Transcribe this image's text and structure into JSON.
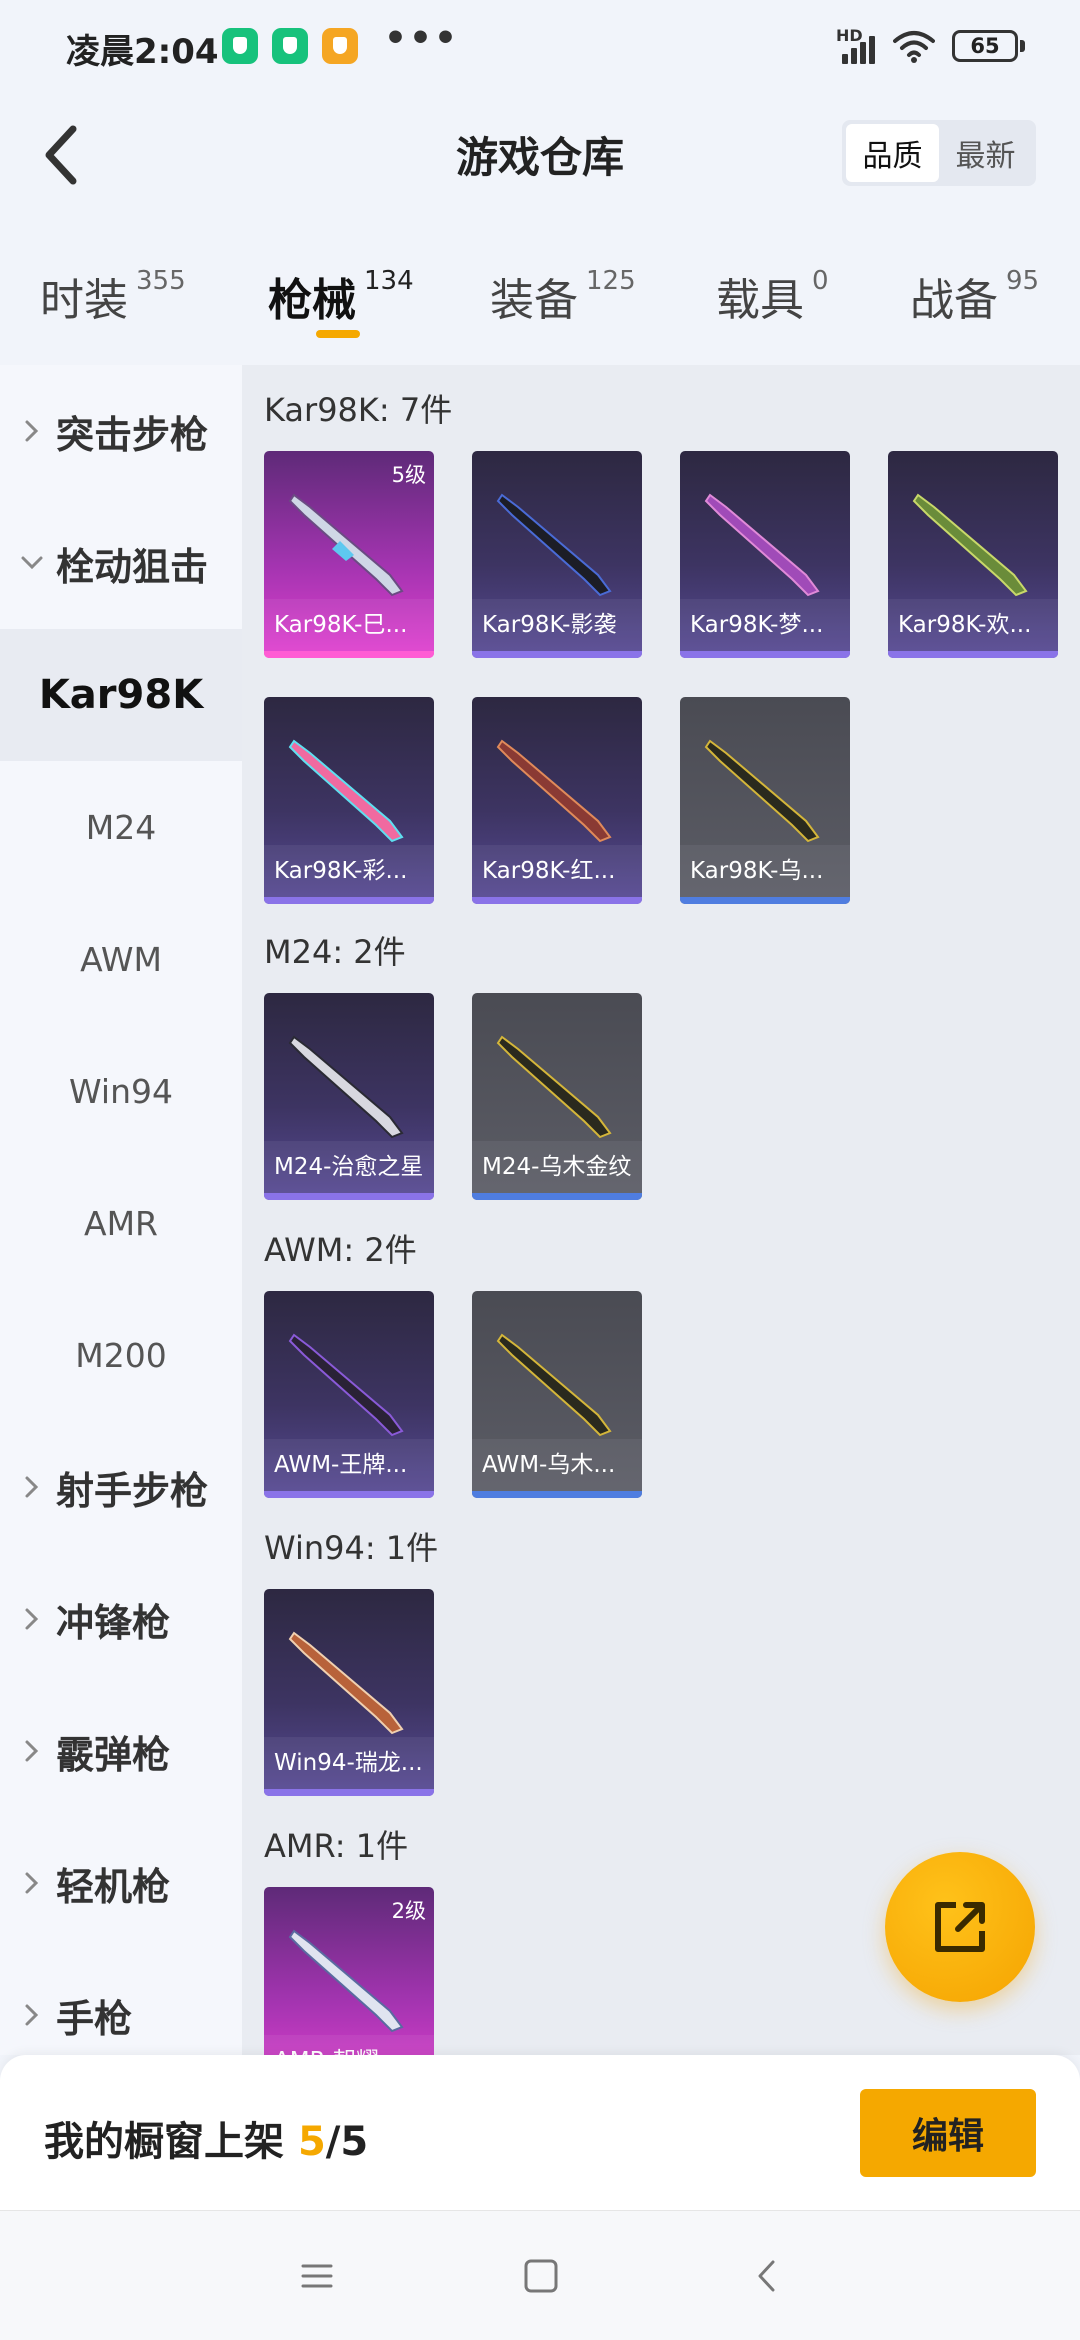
{
  "status_bar": {
    "time": "凌晨2:04",
    "dots": "•••",
    "network": "HD",
    "battery": "65"
  },
  "header": {
    "title": "游戏仓库",
    "sort_options": [
      "品质",
      "最新"
    ],
    "sort_active": "品质"
  },
  "tabs": [
    {
      "label": "时装",
      "count": "355"
    },
    {
      "label": "枪械",
      "count": "134"
    },
    {
      "label": "装备",
      "count": "125"
    },
    {
      "label": "载具",
      "count": "0"
    },
    {
      "label": "战备",
      "count": "95"
    }
  ],
  "sidebar": {
    "groups_top": [
      "突击步枪",
      "栓动狙击"
    ],
    "subitems": [
      "Kar98K",
      "M24",
      "AWM",
      "Win94",
      "AMR",
      "M200"
    ],
    "selected_subitem": "Kar98K",
    "groups_bottom": [
      "射手步枪",
      "冲锋枪",
      "霰弹枪",
      "轻机枪",
      "手枪"
    ]
  },
  "sections": [
    {
      "title": "Kar98K: 7件",
      "items": [
        {
          "label": "Kar98K-巳...",
          "rarity": "pink",
          "level": "5级"
        },
        {
          "label": "Kar98K-影袭",
          "rarity": "purple"
        },
        {
          "label": "Kar98K-梦...",
          "rarity": "purple"
        },
        {
          "label": "Kar98K-欢...",
          "rarity": "purple"
        },
        {
          "label": "Kar98K-彩...",
          "rarity": "purple"
        },
        {
          "label": "Kar98K-红...",
          "rarity": "purple"
        },
        {
          "label": "Kar98K-乌...",
          "rarity": "grey"
        }
      ]
    },
    {
      "title": "M24: 2件",
      "items": [
        {
          "label": "M24-治愈之星",
          "rarity": "purple"
        },
        {
          "label": "M24-乌木金纹",
          "rarity": "grey"
        }
      ]
    },
    {
      "title": "AWM: 2件",
      "items": [
        {
          "label": "AWM-王牌...",
          "rarity": "purple"
        },
        {
          "label": "AWM-乌木...",
          "rarity": "grey"
        }
      ]
    },
    {
      "title": "Win94: 1件",
      "items": [
        {
          "label": "Win94-瑞龙...",
          "rarity": "purple"
        }
      ]
    },
    {
      "title": "AMR: 1件",
      "items": [
        {
          "label": "AMR-朝耀",
          "rarity": "pink",
          "level": "2级"
        }
      ]
    }
  ],
  "bottom": {
    "shelf_label": "我的橱窗上架",
    "shelf_count": "5",
    "shelf_total": "/5",
    "edit_label": "编辑"
  },
  "colors": {
    "accent": "#f5a800",
    "rarity_purple": "#574a95",
    "rarity_pink": "#e240d0",
    "rarity_grey": "#5c5d66"
  },
  "icons": [
    "back-arrow-icon",
    "chevron-right-icon",
    "chevron-down-icon",
    "share-icon",
    "menu-icon",
    "home-square-icon",
    "back-triangle-icon"
  ]
}
